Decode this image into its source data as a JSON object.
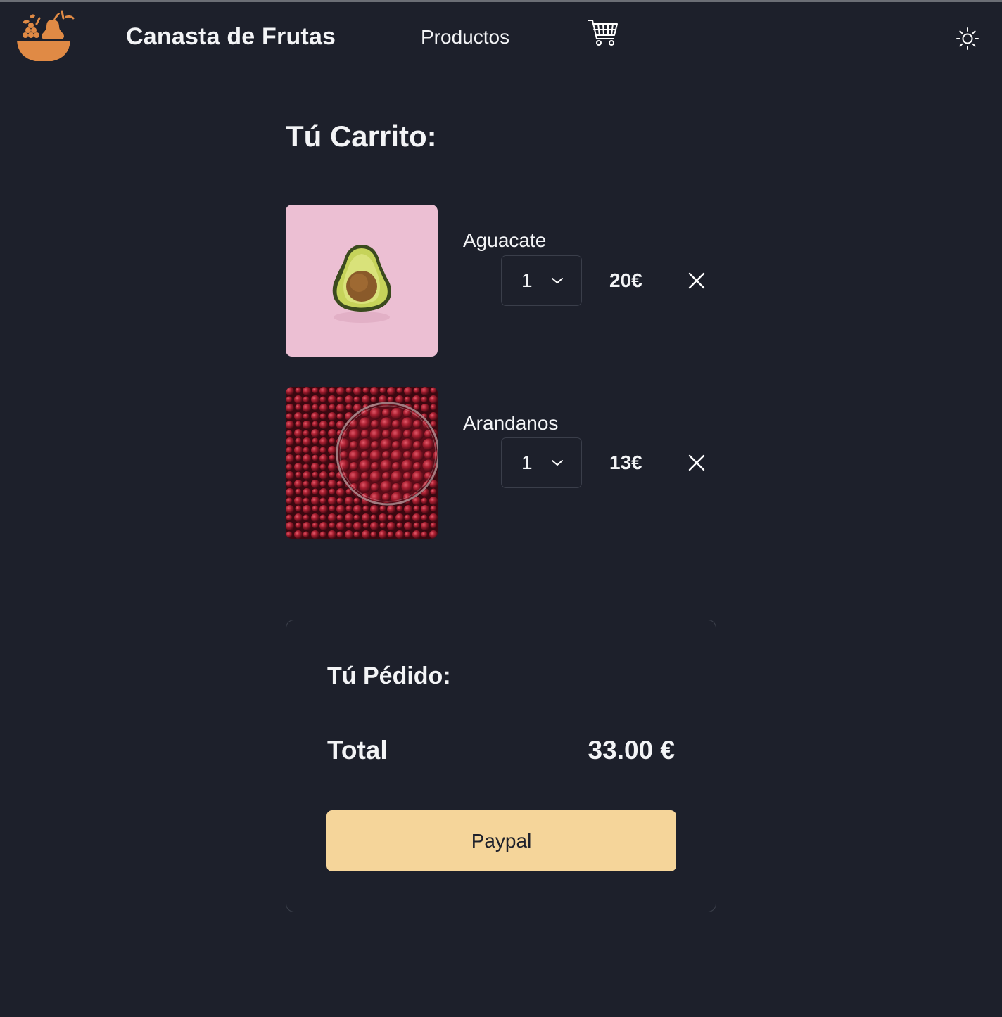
{
  "header": {
    "brand": "Canasta de Frutas",
    "nav_products": "Productos",
    "icons": {
      "logo": "fruit-basket-logo",
      "cart": "shopping-cart-icon",
      "theme": "sun-icon"
    },
    "accent_color": "#e08a45"
  },
  "cart": {
    "title": "Tú Carrito:",
    "items": [
      {
        "name": "Aguacate",
        "quantity": "1",
        "price": "20€",
        "image": "avocado-half-on-pink"
      },
      {
        "name": "Arandanos",
        "quantity": "1",
        "price": "13€",
        "image": "red-cranberries-bowl"
      }
    ]
  },
  "order": {
    "title": "Tú Pédido:",
    "total_label": "Total",
    "total_value": "33.00 €",
    "pay_button": "Paypal",
    "pay_button_color": "#f5d59a"
  },
  "colors": {
    "background": "#1d202b",
    "text": "#f3f4f6",
    "border": "#3c404b"
  }
}
